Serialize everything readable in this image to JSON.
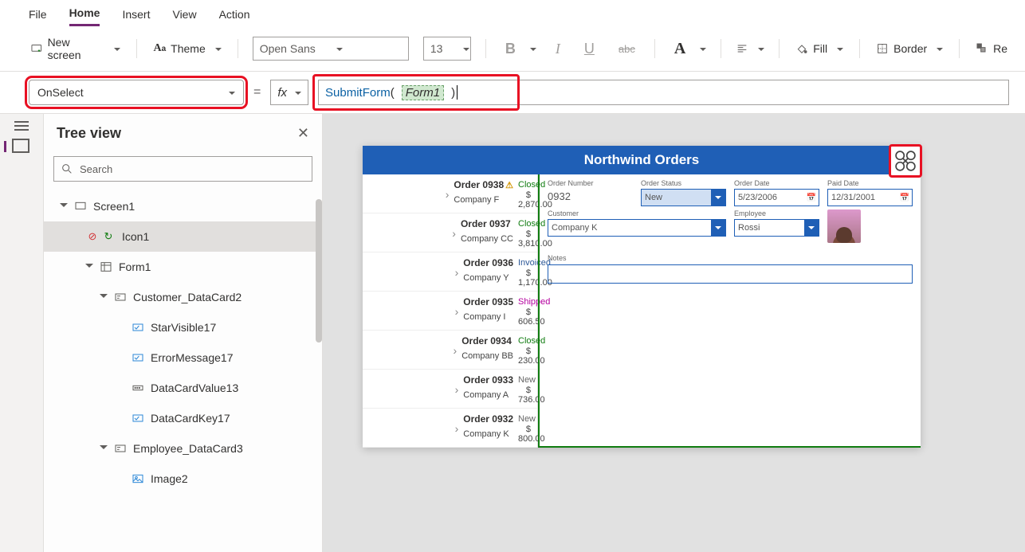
{
  "menu": {
    "items": [
      "File",
      "Home",
      "Insert",
      "View",
      "Action"
    ],
    "active": "Home"
  },
  "toolbar": {
    "newScreen": "New screen",
    "theme": "Theme",
    "fontFamily": "Open Sans",
    "fontSize": "13",
    "fill": "Fill",
    "border": "Border",
    "reorder": "Re"
  },
  "formula": {
    "property": "OnSelect",
    "equals": "=",
    "fx": "fx",
    "fn": "SubmitForm",
    "arg": "Form1",
    "open": "(",
    "close": ")"
  },
  "tree": {
    "title": "Tree view",
    "searchPlaceholder": "Search",
    "items": [
      {
        "label": "Screen1",
        "level": 1,
        "type": "screen",
        "expanded": true
      },
      {
        "label": "Icon1",
        "level": 2,
        "type": "icon",
        "selected": true
      },
      {
        "label": "Form1",
        "level": 2,
        "type": "form",
        "expanded": true
      },
      {
        "label": "Customer_DataCard2",
        "level": 3,
        "type": "card",
        "expanded": true
      },
      {
        "label": "StarVisible17",
        "level": 4,
        "type": "ctrl"
      },
      {
        "label": "ErrorMessage17",
        "level": 4,
        "type": "ctrl"
      },
      {
        "label": "DataCardValue13",
        "level": 4,
        "type": "input"
      },
      {
        "label": "DataCardKey17",
        "level": 4,
        "type": "ctrl"
      },
      {
        "label": "Employee_DataCard3",
        "level": 3,
        "type": "card",
        "expanded": true
      },
      {
        "label": "Image2",
        "level": 4,
        "type": "image"
      }
    ]
  },
  "app": {
    "title": "Northwind Orders",
    "orders": [
      {
        "num": "Order 0938",
        "warn": true,
        "company": "Company F",
        "status": "Closed",
        "amount": "$ 2,870.00"
      },
      {
        "num": "Order 0937",
        "company": "Company CC",
        "status": "Closed",
        "amount": "$ 3,810.00"
      },
      {
        "num": "Order 0936",
        "company": "Company Y",
        "status": "Invoiced",
        "amount": "$ 1,170.00"
      },
      {
        "num": "Order 0935",
        "company": "Company I",
        "status": "Shipped",
        "amount": "$ 606.50"
      },
      {
        "num": "Order 0934",
        "company": "Company BB",
        "status": "Closed",
        "amount": "$ 230.00"
      },
      {
        "num": "Order 0933",
        "company": "Company A",
        "status": "New",
        "amount": "$ 736.00"
      },
      {
        "num": "Order 0932",
        "company": "Company K",
        "status": "New",
        "amount": "$ 800.00"
      }
    ],
    "form": {
      "labels": {
        "orderNumber": "Order Number",
        "orderStatus": "Order Status",
        "orderDate": "Order Date",
        "paidDate": "Paid Date",
        "customer": "Customer",
        "employee": "Employee",
        "notes": "Notes"
      },
      "values": {
        "orderNumber": "0932",
        "orderStatus": "New",
        "orderDate": "5/23/2006",
        "paidDate": "12/31/2001",
        "customer": "Company K",
        "employee": "Rossi"
      }
    }
  }
}
